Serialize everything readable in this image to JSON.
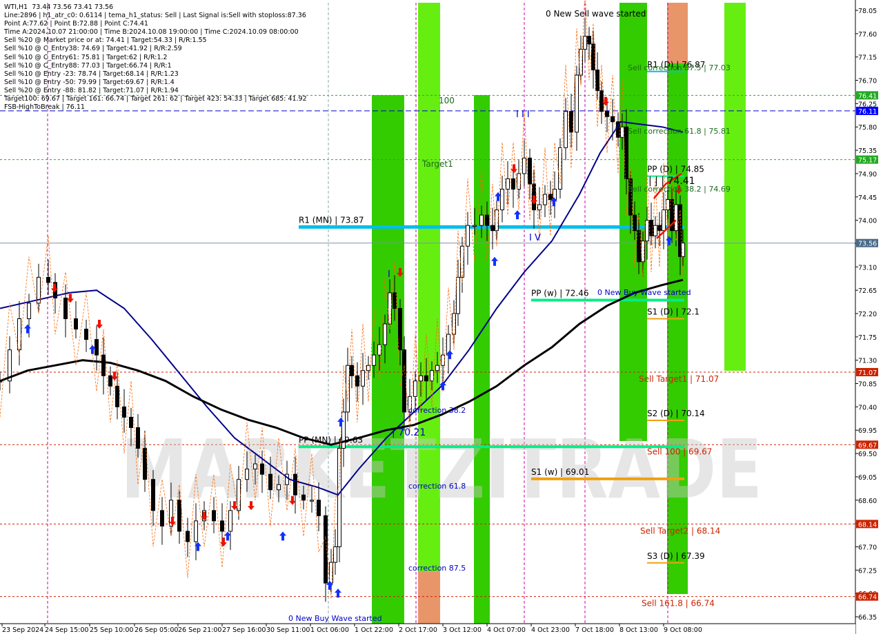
{
  "info_lines": [
    "WTI,H1  73.44 73.56 73.41 73.56",
    "Line:2896 | h1_atr_c0: 0.6114 | tema_h1_status: Sell | Last Signal is:Sell with stoploss:87.36",
    "Point A:77.62 | Point B:72.88 | Point C:74.41",
    "Time A:2024.10.07 21:00:00 | Time B:2024.10.08 19:00:00 | Time C:2024.10.09 08:00:00",
    "Sell %20 @ Market price or at: 74.41 | Target:54.33 | R/R:1.55",
    "Sell %10 @ C_Entry38: 74.69 | Target:41.92 | R/R:2.59",
    "Sell %10 @ C_Entry61: 75.81 | Target:62 | R/R:1.2",
    "Sell %10 @ C_Entry88: 77.03 | Target:66.74 | R/R:1",
    "Sell %10 @ Entry -23: 78.74 | Target:68.14 | R/R:1.23",
    "Sell %10 @ Entry -50: 79.99 | Target:69.67 | R/R:1.4",
    "Sell %20 @ Entry -88: 81.82 | Target:71.07 | R/R:1.94",
    "Target100: 69.67 | Target 161: 66.74 | Target 261: 62 | Target 423: 54.33 | Target 685: 41.92",
    "FSB-HighToBreak | 76.11"
  ],
  "watermark": "MARKETZITRADE",
  "colors": {
    "green_zone": "#33cc00",
    "green_light": "#66ee11",
    "orange_zone": "#e8956a",
    "cyan_level": "#00bfe8",
    "green_level": "#00ee88",
    "orange_level": "#f0a010",
    "red_level_text": "#cc2200",
    "blue_label": "#0000cc",
    "ma_blue": "#00008b",
    "ma_black": "#000000",
    "dashed_orange": "#ff6600",
    "price_current_bg": "#4a6a8a",
    "price_red_bg": "#cc2200",
    "price_green_bg": "#22aa22",
    "price_blue_bg": "#0000ff"
  },
  "chart_data": {
    "type": "candlestick",
    "symbol": "WTI",
    "timeframe": "H1",
    "ylim": [
      66.35,
      78.1
    ],
    "y_ticks": [
      78.05,
      77.6,
      77.15,
      76.7,
      76.25,
      75.8,
      75.35,
      74.9,
      74.45,
      74.0,
      73.55,
      73.1,
      72.65,
      72.2,
      71.75,
      71.3,
      70.85,
      70.4,
      69.95,
      69.5,
      69.05,
      68.6,
      68.15,
      67.7,
      67.25,
      66.8,
      66.35
    ],
    "x_labels": [
      "23 Sep 2024",
      "24 Sep 15:00",
      "25 Sep 10:00",
      "26 Sep 05:00",
      "26 Sep 21:00",
      "27 Sep 16:00",
      "30 Sep 11:00",
      "1 Oct 06:00",
      "1 Oct 22:00",
      "2 Oct 17:00",
      "3 Oct 12:00",
      "4 Oct 07:00",
      "4 Oct 23:00",
      "7 Oct 18:00",
      "8 Oct 13:00",
      "9 Oct 08:00"
    ],
    "price_boxes": [
      {
        "value": "76.41",
        "price": 76.41,
        "kind": "green"
      },
      {
        "value": "76.11",
        "price": 76.11,
        "kind": "blue"
      },
      {
        "value": "75.17",
        "price": 75.17,
        "kind": "green"
      },
      {
        "value": "73.56",
        "price": 73.56,
        "kind": "current"
      },
      {
        "value": "71.07",
        "price": 71.07,
        "kind": "red"
      },
      {
        "value": "69.67",
        "price": 69.67,
        "kind": "red"
      },
      {
        "value": "68.14",
        "price": 68.14,
        "kind": "red"
      },
      {
        "value": "66.74",
        "price": 66.74,
        "kind": "red"
      }
    ],
    "levels": [
      {
        "label": "R1 (MN) | 73.87",
        "price": 73.87,
        "style": "cyan"
      },
      {
        "label": "PP (MN) | 69.63",
        "price": 69.63,
        "style": "green"
      },
      {
        "label": "PP (w) | 72.46",
        "price": 72.46,
        "style": "green"
      },
      {
        "label": "S1 (w) | 69.01",
        "price": 69.01,
        "style": "orange"
      },
      {
        "label": "R1 (D) | 76.87",
        "price": 76.87,
        "style": "cyan"
      },
      {
        "label": "PP (D) | 74.85",
        "price": 74.85,
        "style": "green"
      },
      {
        "label": "S1 (D) | 72.1",
        "price": 72.1,
        "style": "orange"
      },
      {
        "label": "S2 (D) | 70.14",
        "price": 70.14,
        "style": "orange"
      },
      {
        "label": "S3 (D) | 67.39",
        "price": 67.39,
        "style": "orange"
      }
    ],
    "target_labels": [
      {
        "label": "Sell Target1 | 71.07",
        "price": 71.07
      },
      {
        "label": "Sell 100 | 69.67",
        "price": 69.67
      },
      {
        "label": "Sell Target2 | 68.14",
        "price": 68.14
      },
      {
        "label": "Sell 161.8 | 66.74",
        "price": 66.74
      }
    ],
    "annotations": [
      {
        "text": "0 New Sell wave started"
      },
      {
        "text": "0 New Buy Wave started"
      },
      {
        "text": "0 New Buy Wave started"
      },
      {
        "text": "Sell correction 87.5 | 77.03"
      },
      {
        "text": "Sell correction 61.8 | 75.81"
      },
      {
        "text": "Sell correction 38.2 | 74.69"
      },
      {
        "text": "| | | 74.41"
      },
      {
        "text": "correction 38.2"
      },
      {
        "text": "correction 61.8"
      },
      {
        "text": "correction 87.5"
      },
      {
        "text": "| 70.21"
      },
      {
        "text": "Target1"
      },
      {
        "text": "100"
      },
      {
        "text": "I V"
      },
      {
        "text": "I I I"
      },
      {
        "text": "I"
      }
    ],
    "series": [
      {
        "name": "Price",
        "kind": "close",
        "values": [
          [
            0,
            70.9
          ],
          [
            14,
            71.5
          ],
          [
            28,
            72.1
          ],
          [
            42,
            72.4
          ],
          [
            56,
            72.9
          ],
          [
            70,
            72.8
          ],
          [
            80,
            72.5
          ],
          [
            95,
            72.1
          ],
          [
            110,
            71.9
          ],
          [
            125,
            71.7
          ],
          [
            140,
            71.4
          ],
          [
            150,
            71.0
          ],
          [
            160,
            70.8
          ],
          [
            170,
            70.4
          ],
          [
            180,
            70.2
          ],
          [
            190,
            70.0
          ],
          [
            200,
            69.6
          ],
          [
            210,
            69.0
          ],
          [
            222,
            68.4
          ],
          [
            235,
            68.1
          ],
          [
            248,
            68.6
          ],
          [
            260,
            68.0
          ],
          [
            272,
            67.8
          ],
          [
            284,
            68.2
          ],
          [
            296,
            68.4
          ],
          [
            310,
            68.2
          ],
          [
            322,
            68.0
          ],
          [
            334,
            68.4
          ],
          [
            346,
            69.0
          ],
          [
            358,
            69.2
          ],
          [
            370,
            69.3
          ],
          [
            380,
            69.1
          ],
          [
            392,
            68.8
          ],
          [
            404,
            68.9
          ],
          [
            416,
            69.1
          ],
          [
            428,
            68.7
          ],
          [
            440,
            68.6
          ],
          [
            452,
            68.6
          ],
          [
            462,
            68.3
          ],
          [
            472,
            67.0
          ],
          [
            480,
            67.4
          ],
          [
            486,
            67.7
          ],
          [
            492,
            69.6
          ],
          [
            498,
            70.3
          ],
          [
            504,
            71.2
          ],
          [
            510,
            71.0
          ],
          [
            518,
            70.8
          ],
          [
            526,
            71.1
          ],
          [
            534,
            71.2
          ],
          [
            542,
            71.4
          ],
          [
            550,
            71.6
          ],
          [
            558,
            72.0
          ],
          [
            565,
            72.6
          ],
          [
            572,
            72.3
          ],
          [
            580,
            71.5
          ],
          [
            586,
            70.3
          ],
          [
            594,
            70.6
          ],
          [
            602,
            70.9
          ],
          [
            610,
            71.0
          ],
          [
            618,
            70.9
          ],
          [
            626,
            71.1
          ],
          [
            634,
            71.2
          ],
          [
            642,
            71.4
          ],
          [
            650,
            71.8
          ],
          [
            658,
            72.2
          ],
          [
            664,
            72.9
          ],
          [
            670,
            73.5
          ],
          [
            678,
            73.9
          ],
          [
            688,
            73.9
          ],
          [
            698,
            74.1
          ],
          [
            706,
            73.9
          ],
          [
            714,
            73.8
          ],
          [
            720,
            74.2
          ],
          [
            728,
            74.6
          ],
          [
            736,
            74.8
          ],
          [
            744,
            74.6
          ],
          [
            752,
            74.9
          ],
          [
            760,
            75.2
          ],
          [
            768,
            74.7
          ],
          [
            774,
            74.2
          ],
          [
            782,
            74.3
          ],
          [
            790,
            74.5
          ],
          [
            798,
            74.4
          ],
          [
            804,
            74.6
          ],
          [
            812,
            75.4
          ],
          [
            820,
            76.1
          ],
          [
            828,
            75.7
          ],
          [
            836,
            76.8
          ],
          [
            842,
            77.3
          ],
          [
            848,
            77.55
          ],
          [
            854,
            77.4
          ],
          [
            860,
            76.9
          ],
          [
            866,
            76.5
          ],
          [
            872,
            76.1
          ],
          [
            880,
            76.0
          ],
          [
            888,
            75.9
          ],
          [
            896,
            75.6
          ],
          [
            902,
            75.8
          ],
          [
            908,
            74.8
          ],
          [
            914,
            74.1
          ],
          [
            920,
            73.8
          ],
          [
            926,
            73.2
          ],
          [
            932,
            73.6
          ],
          [
            938,
            74.0
          ],
          [
            944,
            73.7
          ],
          [
            950,
            73.9
          ],
          [
            956,
            73.8
          ],
          [
            962,
            74.2
          ],
          [
            968,
            74.4
          ],
          [
            974,
            73.8
          ],
          [
            980,
            74.3
          ],
          [
            986,
            73.3
          ],
          [
            990,
            73.56
          ]
        ]
      },
      {
        "name": "MA blue",
        "kind": "ma",
        "values": [
          [
            0,
            72.3
          ],
          [
            50,
            72.45
          ],
          [
            100,
            72.6
          ],
          [
            140,
            72.65
          ],
          [
            180,
            72.3
          ],
          [
            220,
            71.7
          ],
          [
            260,
            71.05
          ],
          [
            300,
            70.4
          ],
          [
            340,
            69.8
          ],
          [
            380,
            69.4
          ],
          [
            420,
            69.0
          ],
          [
            460,
            68.85
          ],
          [
            490,
            68.7
          ],
          [
            520,
            69.2
          ],
          [
            560,
            69.8
          ],
          [
            600,
            70.3
          ],
          [
            640,
            70.8
          ],
          [
            680,
            71.5
          ],
          [
            720,
            72.3
          ],
          [
            760,
            73.0
          ],
          [
            800,
            73.6
          ],
          [
            840,
            74.5
          ],
          [
            870,
            75.3
          ],
          [
            900,
            75.9
          ],
          [
            930,
            75.85
          ],
          [
            960,
            75.8
          ],
          [
            990,
            75.7
          ]
        ]
      },
      {
        "name": "MA black",
        "kind": "ma",
        "values": [
          [
            0,
            70.9
          ],
          [
            40,
            71.1
          ],
          [
            80,
            71.2
          ],
          [
            120,
            71.3
          ],
          [
            160,
            71.25
          ],
          [
            200,
            71.1
          ],
          [
            240,
            70.9
          ],
          [
            280,
            70.6
          ],
          [
            320,
            70.35
          ],
          [
            360,
            70.15
          ],
          [
            400,
            70.0
          ],
          [
            440,
            69.8
          ],
          [
            480,
            69.67
          ],
          [
            520,
            69.8
          ],
          [
            560,
            69.95
          ],
          [
            600,
            70.05
          ],
          [
            640,
            70.25
          ],
          [
            680,
            70.5
          ],
          [
            720,
            70.8
          ],
          [
            760,
            71.2
          ],
          [
            800,
            71.55
          ],
          [
            840,
            72.0
          ],
          [
            880,
            72.35
          ],
          [
            920,
            72.6
          ],
          [
            960,
            72.75
          ],
          [
            990,
            72.85
          ]
        ]
      }
    ]
  }
}
